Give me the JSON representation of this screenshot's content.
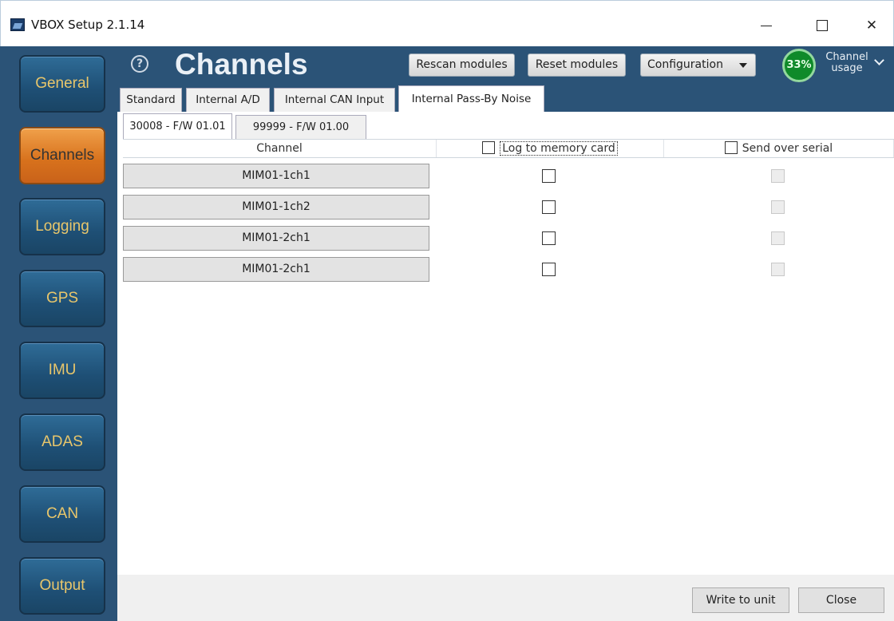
{
  "window": {
    "title": "VBOX Setup 2.1.14"
  },
  "sidebar": {
    "items": [
      {
        "label": "General"
      },
      {
        "label": "Channels"
      },
      {
        "label": "Logging"
      },
      {
        "label": "GPS"
      },
      {
        "label": "IMU"
      },
      {
        "label": "ADAS"
      },
      {
        "label": "CAN"
      },
      {
        "label": "Output"
      }
    ],
    "active": "Channels"
  },
  "header": {
    "help_glyph": "?",
    "title": "Channels",
    "rescan_label": "Rescan modules",
    "reset_label": "Reset modules",
    "config_label": "Configuration",
    "usage_percent": "33%",
    "usage_label_line1": "Channel",
    "usage_label_line2": "usage"
  },
  "tabs": [
    {
      "label": "Standard"
    },
    {
      "label": "Internal A/D"
    },
    {
      "label": "Internal CAN Input"
    },
    {
      "label": "Internal Pass-By Noise"
    }
  ],
  "active_tab": "Internal Pass-By Noise",
  "subtabs": [
    {
      "label": "30008 - F/W 01.01"
    },
    {
      "label": "99999 - F/W 01.00"
    }
  ],
  "grid": {
    "col_channel": "Channel",
    "col_log": "Log to memory card",
    "col_serial": "Send over serial",
    "rows": [
      {
        "channel": "MIM01-1ch1",
        "log": false,
        "serial": false
      },
      {
        "channel": "MIM01-1ch2",
        "log": false,
        "serial": false
      },
      {
        "channel": "MIM01-2ch1",
        "log": false,
        "serial": false
      },
      {
        "channel": "MIM01-2ch1",
        "log": false,
        "serial": false
      }
    ]
  },
  "footer": {
    "write_label": "Write to unit",
    "close_label": "Close"
  },
  "colors": {
    "sidebar_bg": "#2b5377",
    "nav_text": "#e8c66b",
    "nav_active": "#d7711c",
    "gauge": "#0f8a2a"
  }
}
